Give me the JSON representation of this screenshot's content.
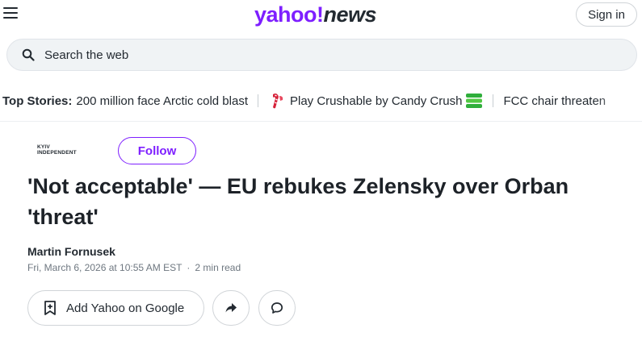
{
  "header": {
    "logo_yahoo": "yahoo!",
    "logo_news": "news",
    "signin_label": "Sign in",
    "brand_color": "#7e1fff"
  },
  "search": {
    "placeholder": "Search the web"
  },
  "top_stories": {
    "label": "Top Stories:",
    "items": [
      "200 million face Arctic cold blast",
      "Play Crushable by Candy Crush",
      "FCC chair threaten"
    ]
  },
  "article": {
    "publisher_line1": "KYIV",
    "publisher_line2": "INDEPENDENT",
    "follow_label": "Follow",
    "headline": "'Not acceptable' — EU rebukes Zelensky over Orban 'threat'",
    "author": "Martin Fornusek",
    "timestamp": "Fri, March 6, 2026 at 10:55 AM EST",
    "read_time": "2 min read",
    "add_google_label": "Add Yahoo on Google"
  },
  "icons": {
    "menu": "hamburger-menu-icon",
    "search": "search-icon",
    "candy": "candy-icon",
    "crushable": "crushable-icon",
    "google_add": "add-bookmark-icon",
    "share": "share-arrow-icon",
    "comment": "comment-bubble-icon"
  }
}
